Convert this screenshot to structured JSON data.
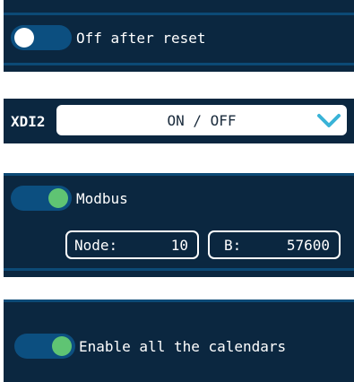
{
  "reset": {
    "label": "Off after reset",
    "toggle_state": "off"
  },
  "xdi": {
    "label": "XDI2",
    "value": "ON / OFF",
    "icon": "chevron-down-icon",
    "chevron_color": "#39b3d7"
  },
  "modbus": {
    "label": "Modbus",
    "toggle_state": "on",
    "node": {
      "label": "Node:",
      "value": "10"
    },
    "baud": {
      "label": "B:",
      "value": "57600"
    }
  },
  "calendars": {
    "label": "Enable all the calendars",
    "toggle_state": "on"
  },
  "colors": {
    "panel": "#0b2740",
    "toggle_track": "#0c4f80",
    "toggle_on_knob": "#5fc473",
    "accent_bar": "#0c4a76"
  }
}
